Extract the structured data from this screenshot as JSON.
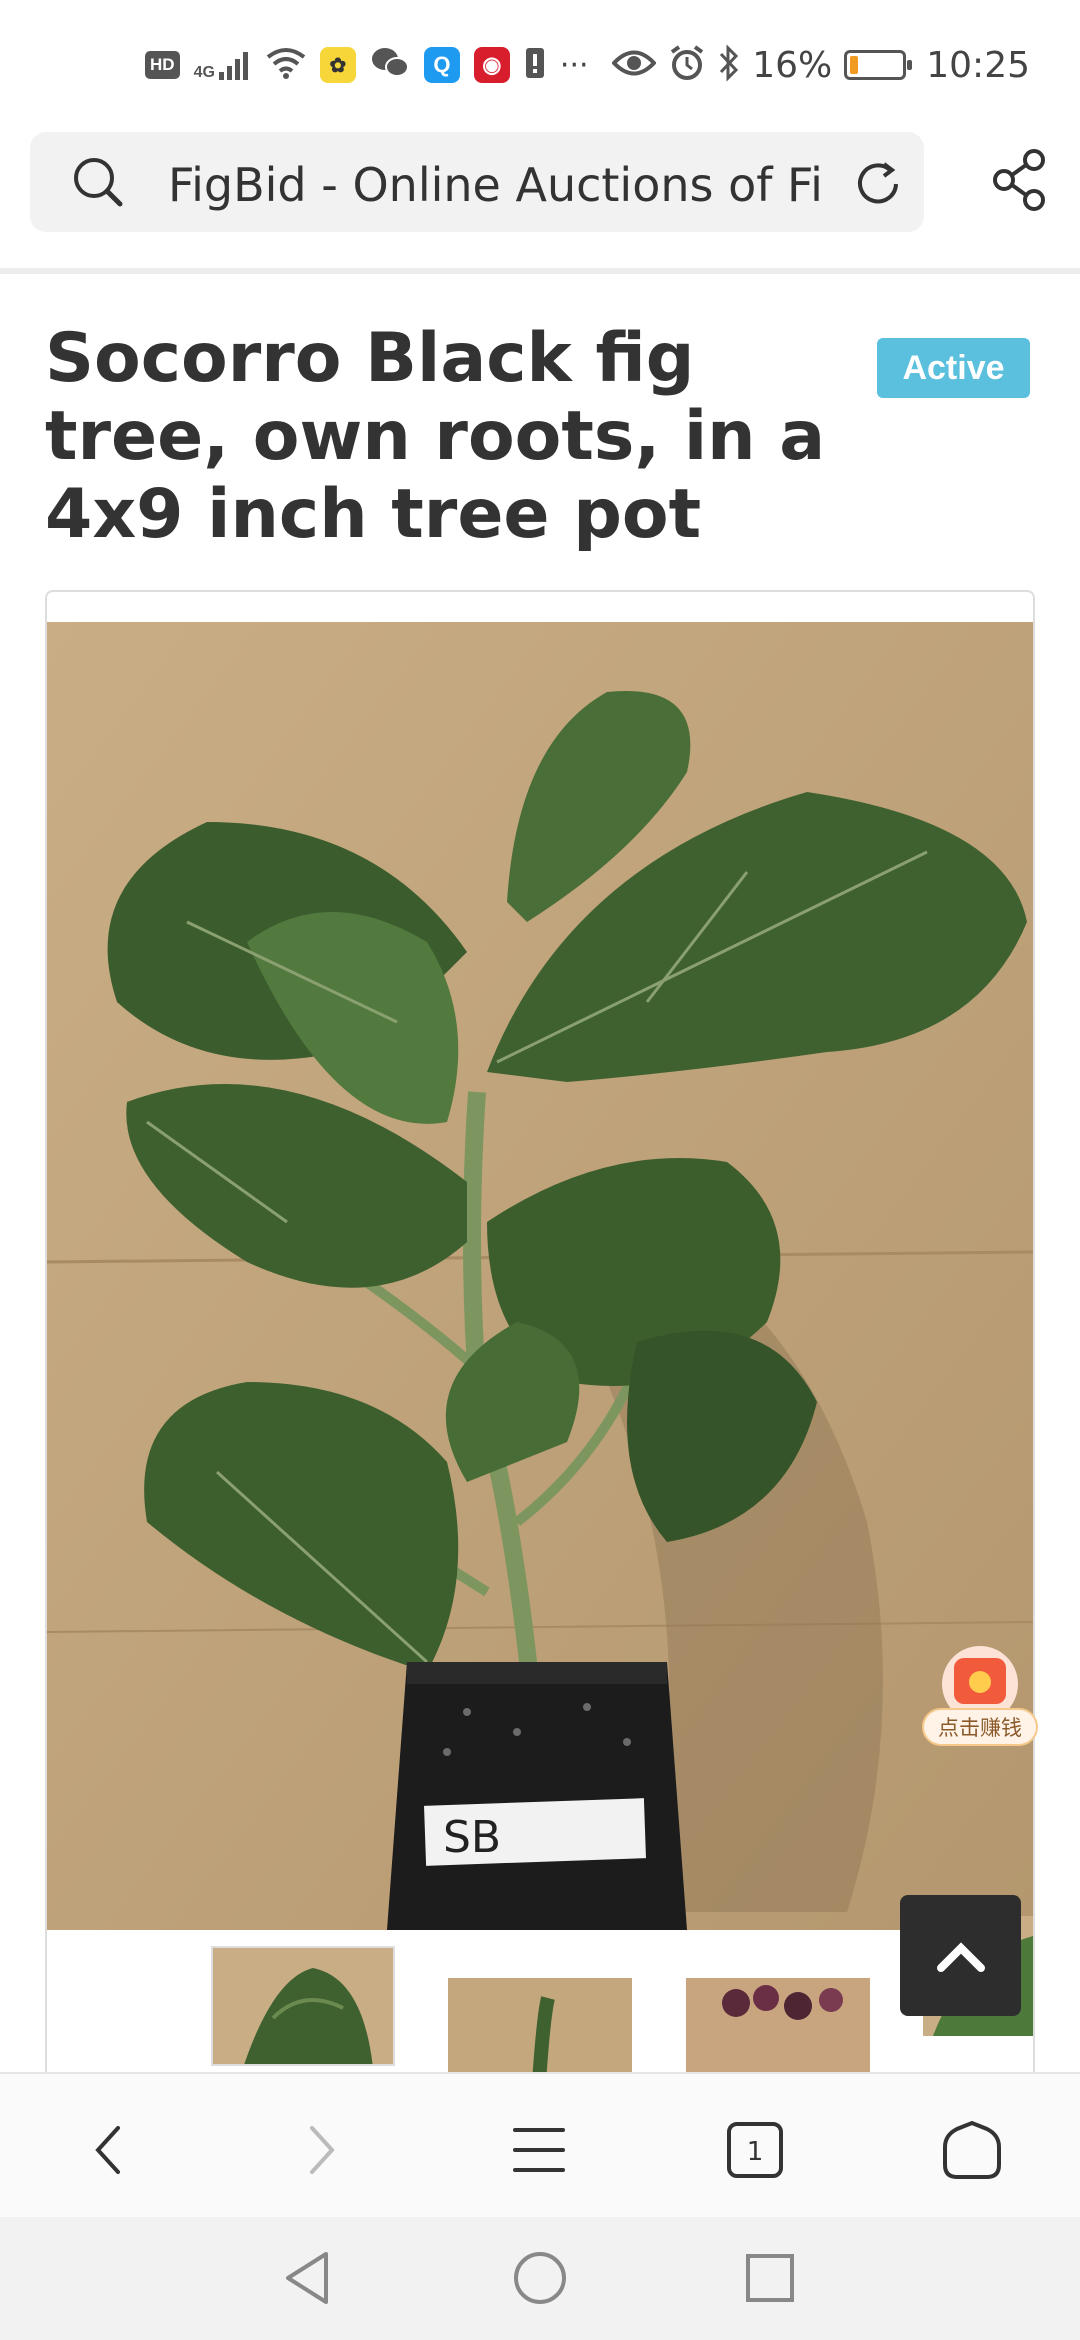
{
  "status_bar": {
    "hd_label": "HD",
    "network_label": "4G",
    "more_label": "···",
    "battery_percent": "16%",
    "battery_level": 0.16,
    "time": "10:25",
    "icons": [
      "signal-icon",
      "wifi-icon",
      "app-rabbit-icon",
      "wechat-icon",
      "app-q-icon",
      "weibo-icon",
      "phone-alert-icon",
      "eye-icon",
      "alarm-icon",
      "bluetooth-icon",
      "battery-icon"
    ]
  },
  "browser": {
    "page_title": "FigBid - Online Auctions of Fi",
    "icons": [
      "search-icon",
      "reload-icon",
      "share-icon"
    ]
  },
  "listing": {
    "title": "Socorro Black fig tree, own roots, in a 4x9 inch tree pot",
    "status": "Active",
    "status_color": "#5bc0de",
    "pot_label": "SB",
    "thumbnail_count": 5
  },
  "floating_widget": {
    "label": "点击赚钱"
  },
  "bottom_nav": {
    "tab_count": "1",
    "icons": [
      "back-icon",
      "forward-icon",
      "menu-icon",
      "tabs-icon",
      "home-icon"
    ]
  },
  "system_nav": {
    "icons": [
      "triangle-back-icon",
      "circle-home-icon",
      "square-recents-icon"
    ]
  }
}
